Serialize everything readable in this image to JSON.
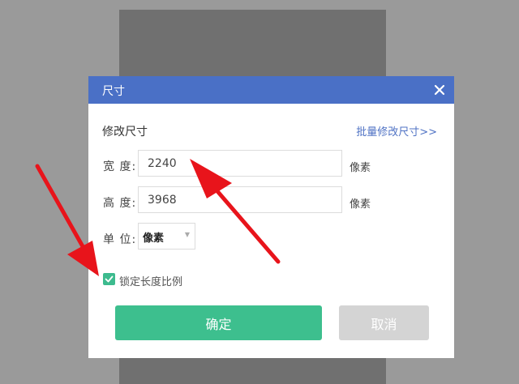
{
  "dialog": {
    "title": "尺寸",
    "close_icon": "close-icon",
    "section_title": "修改尺寸",
    "batch_link": "批量修改尺寸>>",
    "width": {
      "label": "宽 度:",
      "value": "2240",
      "unit": "像素"
    },
    "height": {
      "label": "高 度:",
      "value": "3968",
      "unit": "像素"
    },
    "unit": {
      "label": "单 位:",
      "selected": "像素",
      "caret_icon": "chevron-down-icon"
    },
    "lock_ratio": {
      "label": "锁定长度比例",
      "checked": true
    },
    "ok_label": "确定",
    "cancel_label": "取消"
  },
  "annotations": {
    "arrow_color": "#e8141b"
  },
  "colors": {
    "titlebar": "#4a70c6",
    "primary_button": "#3dbf8e",
    "disabled_button": "#d4d4d4",
    "link": "#4f72c4"
  }
}
